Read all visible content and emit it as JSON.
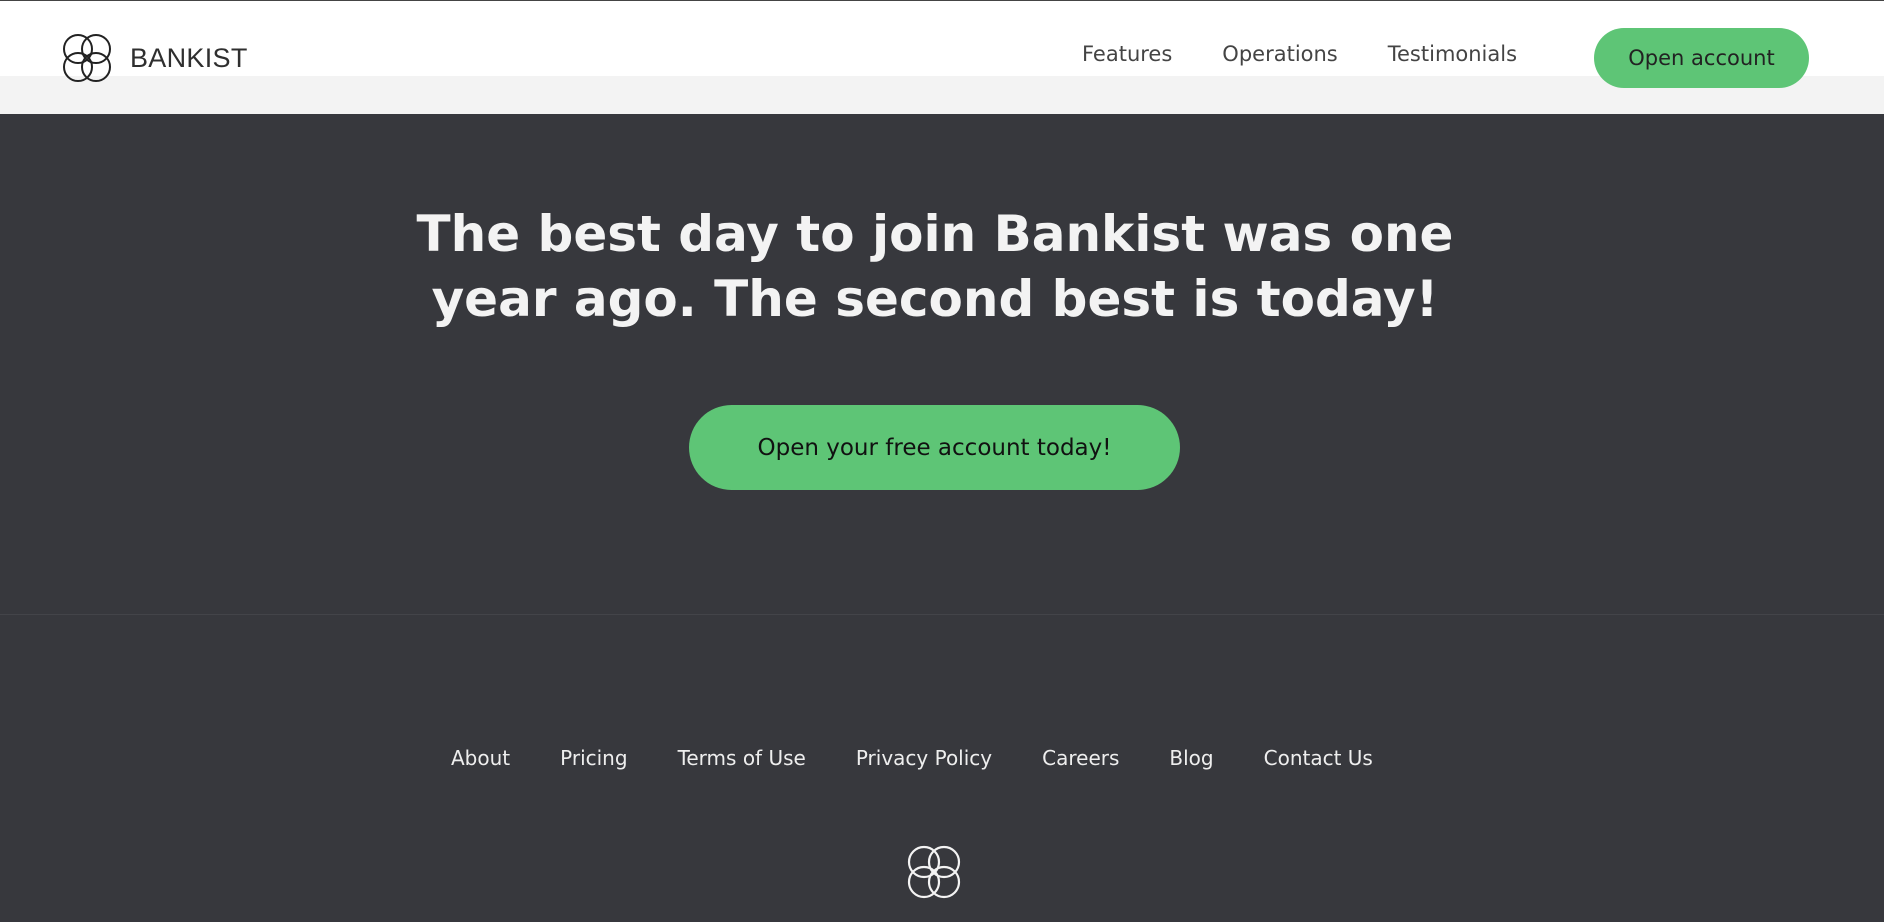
{
  "brand": {
    "name": "BANKIST"
  },
  "nav": {
    "links": [
      "Features",
      "Operations",
      "Testimonials"
    ],
    "cta_label": "Open account"
  },
  "signup": {
    "title_line1": "The best day to join Bankist was one",
    "title_line2": "year ago. The second best is today!",
    "cta_label": "Open your free account today!"
  },
  "footer": {
    "links": [
      "About",
      "Pricing",
      "Terms of Use",
      "Privacy Policy",
      "Careers",
      "Blog",
      "Contact Us"
    ],
    "logo_icon": "four-circle-logo-icon"
  },
  "colors": {
    "accent": "#5ec576",
    "dark": "#37383d",
    "light": "#f3f3f3"
  }
}
